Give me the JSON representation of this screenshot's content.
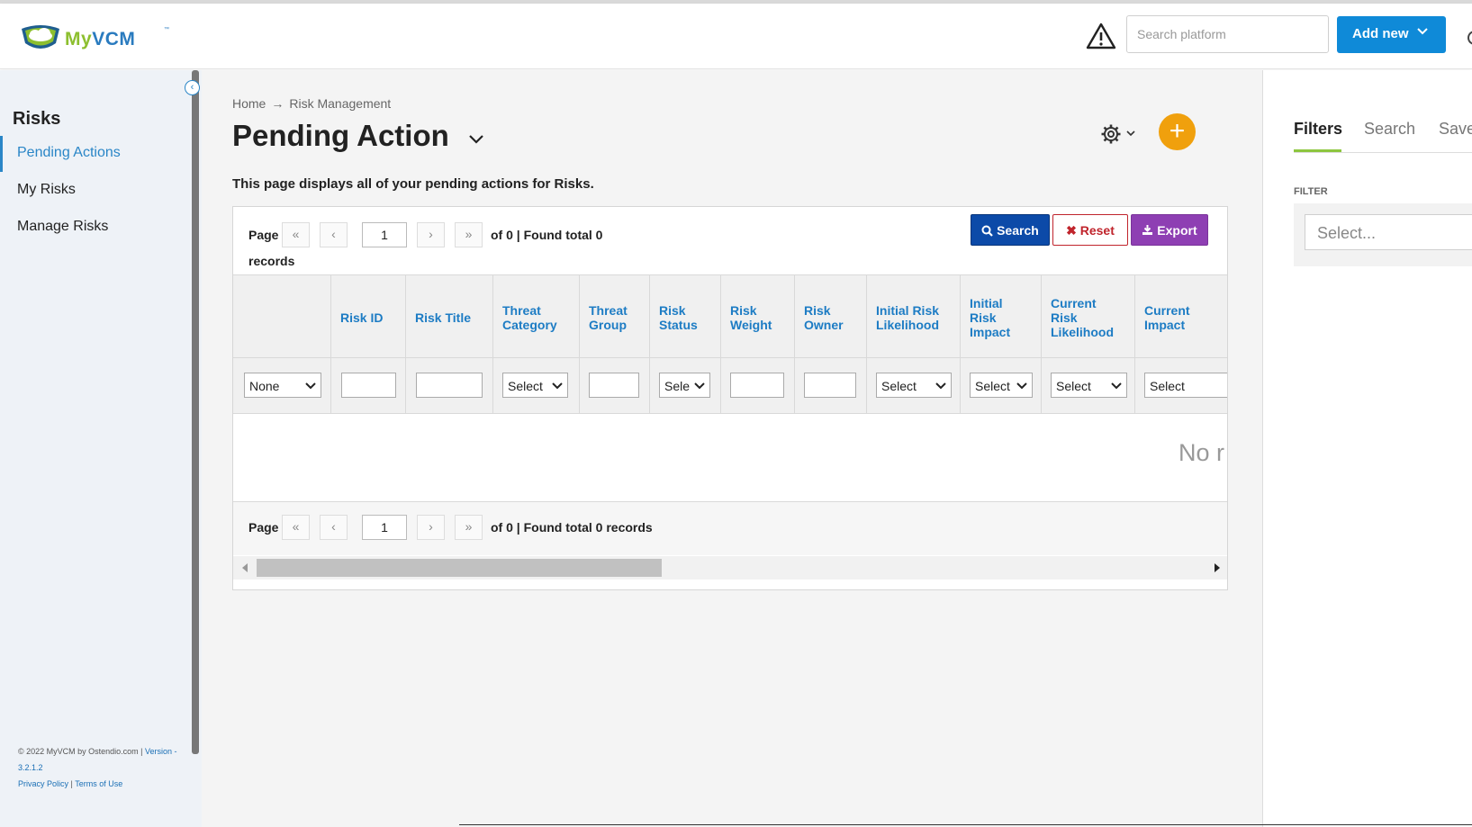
{
  "header": {
    "logo": {
      "part1": "My",
      "part2": "VCM",
      "tm": "™"
    },
    "search_placeholder": "Search platform",
    "add_new_label": "Add new"
  },
  "sidebar": {
    "title": "Risks",
    "items": [
      {
        "label": "Pending Actions",
        "active": true
      },
      {
        "label": "My Risks",
        "active": false
      },
      {
        "label": "Manage Risks",
        "active": false
      }
    ],
    "footer": {
      "copyright": "© 2022 MyVCM by Ostendio.com | ",
      "version_label": "Version - 3.2.1.2",
      "privacy": "Privacy Policy",
      "sep": " | ",
      "terms": "Terms of Use"
    }
  },
  "main": {
    "breadcrumb": {
      "home": "Home",
      "arrow": "→",
      "current": "Risk Management"
    },
    "title": "Pending Action",
    "description": "This page displays all of your pending actions for Risks.",
    "pager_top": {
      "page_label": "Page",
      "page_value": "1",
      "summary": "of 0 | Found total 0",
      "summary2": "records"
    },
    "pager_bottom": {
      "page_label": "Page",
      "page_value": "1",
      "summary": "of 0 | Found total 0 records"
    },
    "buttons": {
      "search": "Search",
      "reset": "Reset",
      "export": "Export"
    },
    "columns": [
      {
        "label": ""
      },
      {
        "label": "Risk ID"
      },
      {
        "label": "Risk Title"
      },
      {
        "label": "Threat Category"
      },
      {
        "label": "Threat Group"
      },
      {
        "label": "Risk Status"
      },
      {
        "label": "Risk Weight"
      },
      {
        "label": "Risk Owner"
      },
      {
        "label": "Initial Risk Likelihood"
      },
      {
        "label": "Initial Risk Impact"
      },
      {
        "label": "Current Risk Likelihood"
      },
      {
        "label": "Current Impact"
      }
    ],
    "filters": {
      "none": "None",
      "threat_category": "Select",
      "risk_status": "Sele",
      "initial_likelihood": "Select",
      "initial_impact": "Select",
      "current_likelihood": "Select",
      "current_impact": "Select"
    },
    "no_records": "No r"
  },
  "right_panel": {
    "tabs": [
      "Filters",
      "Search",
      "Save"
    ],
    "filter_label": "FILTER",
    "filter_placeholder": "Select..."
  },
  "colors": {
    "accent_blue": "#2a86c7",
    "add_new": "#0f8ad8",
    "plus_orange": "#f0a00d",
    "search_btn": "#0c4aa8",
    "reset_red": "#c0242c",
    "export_purple": "#8e3fb3",
    "tab_green": "#8dc63f"
  }
}
